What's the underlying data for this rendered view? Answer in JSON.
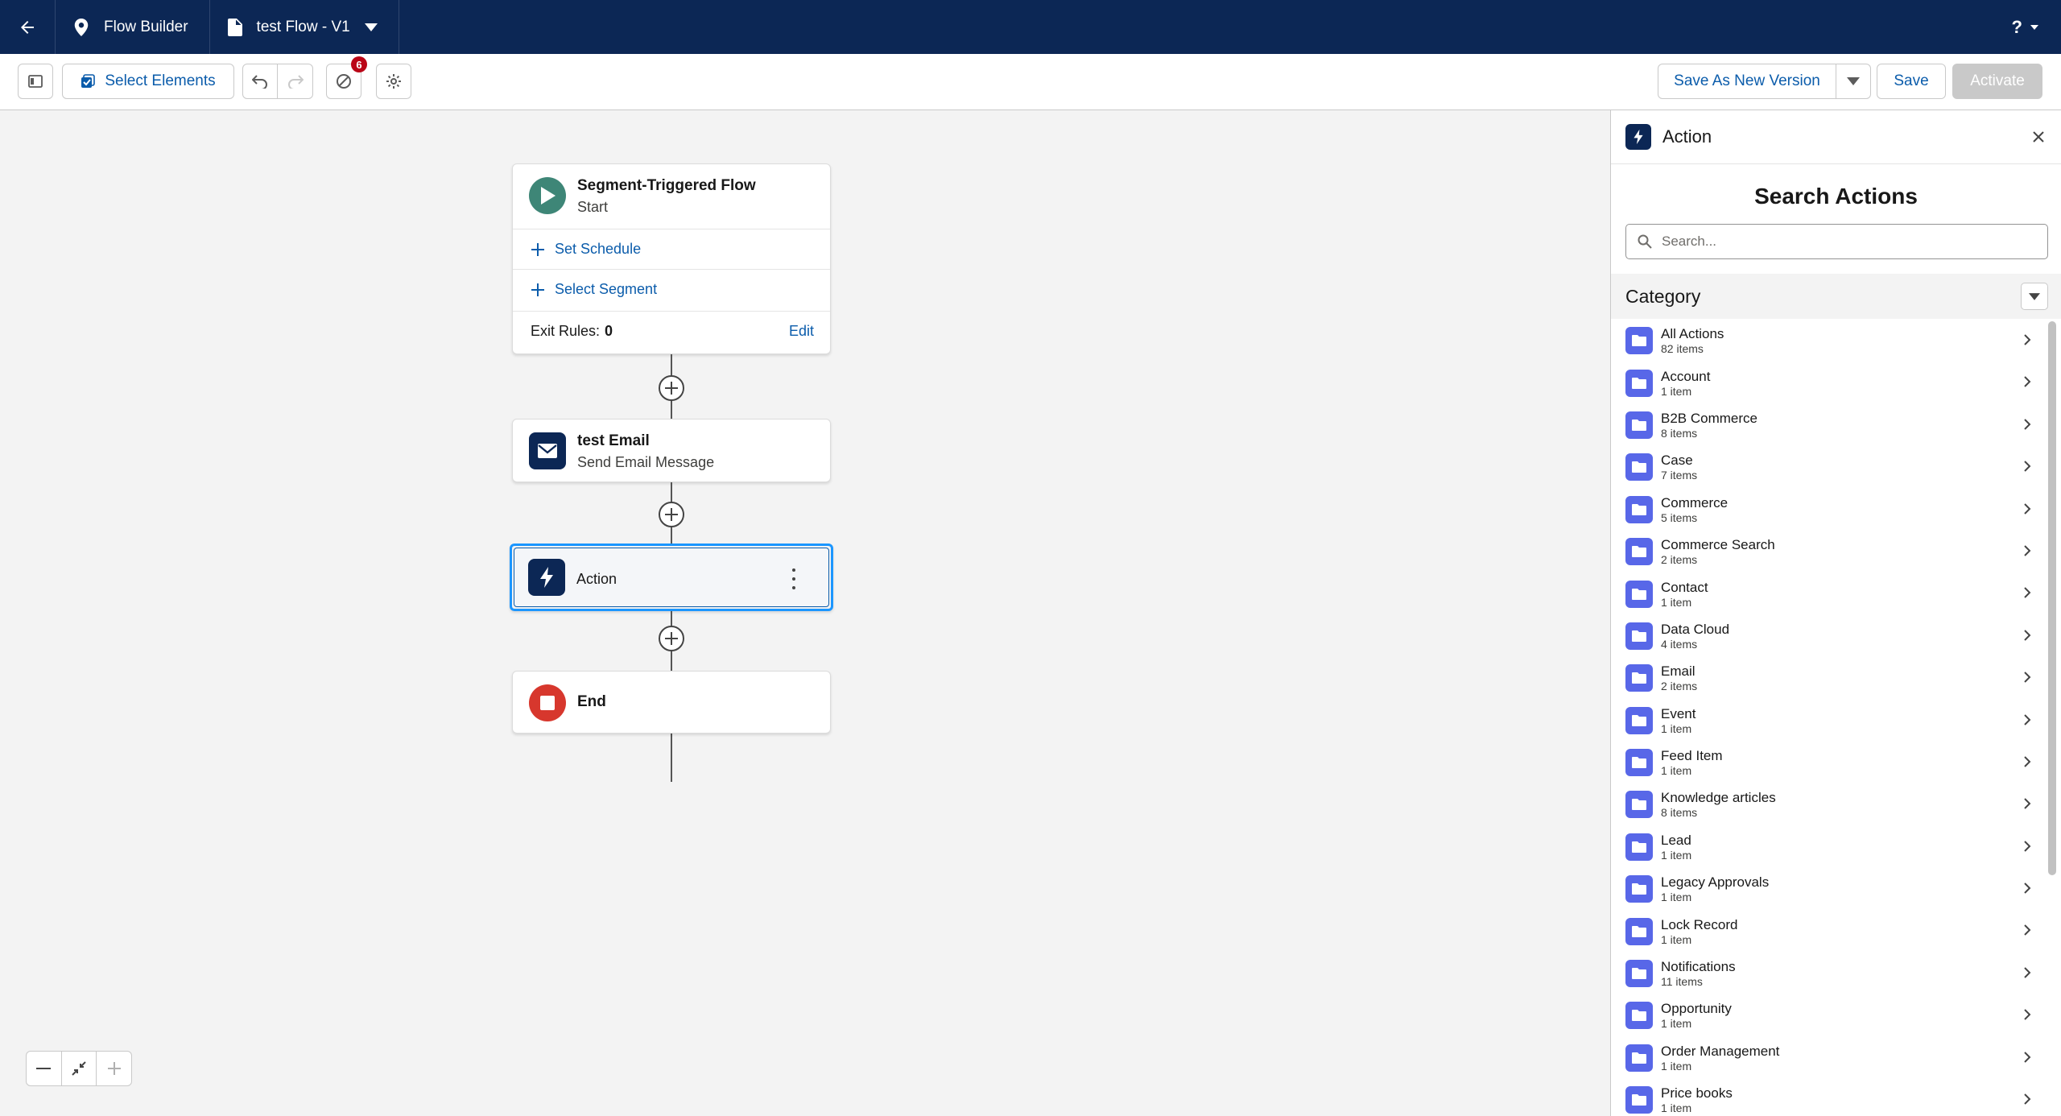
{
  "topbar": {
    "app_name": "Flow Builder",
    "flow_name": "test Flow - V1",
    "help_label": "?"
  },
  "toolbar": {
    "select_elements_label": "Select Elements",
    "error_count": "6",
    "save_as_new_version_label": "Save As New Version",
    "save_label": "Save",
    "activate_label": "Activate"
  },
  "canvas": {
    "start": {
      "title": "Segment-Triggered Flow",
      "subtitle": "Start",
      "set_schedule": "Set Schedule",
      "select_segment": "Select Segment",
      "exit_rules_label": "Exit Rules:",
      "exit_rules_value": "0",
      "edit_label": "Edit"
    },
    "email_node": {
      "title": "test Email",
      "subtitle": "Send Email Message"
    },
    "action_node": {
      "title": "Action"
    },
    "end_node": {
      "title": "End"
    }
  },
  "panel": {
    "header_title": "Action",
    "search_title": "Search Actions",
    "search_placeholder": "Search...",
    "category_label": "Category",
    "categories": [
      {
        "name": "All Actions",
        "count": "82 items"
      },
      {
        "name": "Account",
        "count": "1 item"
      },
      {
        "name": "B2B Commerce",
        "count": "8 items"
      },
      {
        "name": "Case",
        "count": "7 items"
      },
      {
        "name": "Commerce",
        "count": "5 items"
      },
      {
        "name": "Commerce Search",
        "count": "2 items"
      },
      {
        "name": "Contact",
        "count": "1 item"
      },
      {
        "name": "Data Cloud",
        "count": "4 items"
      },
      {
        "name": "Email",
        "count": "2 items"
      },
      {
        "name": "Event",
        "count": "1 item"
      },
      {
        "name": "Feed Item",
        "count": "1 item"
      },
      {
        "name": "Knowledge articles",
        "count": "8 items"
      },
      {
        "name": "Lead",
        "count": "1 item"
      },
      {
        "name": "Legacy Approvals",
        "count": "1 item"
      },
      {
        "name": "Lock Record",
        "count": "1 item"
      },
      {
        "name": "Notifications",
        "count": "11 items"
      },
      {
        "name": "Opportunity",
        "count": "1 item"
      },
      {
        "name": "Order Management",
        "count": "1 item"
      },
      {
        "name": "Price books",
        "count": "1 item"
      }
    ]
  },
  "colors": {
    "topbar": "#0c2755",
    "brand_blue": "#0b5cab",
    "start_icon": "#3e8677",
    "end_icon": "#d7372d",
    "folder_icon": "#5867e8",
    "error_badge": "#ba0517"
  },
  "icons": {
    "back": "arrow-left-icon",
    "app": "location-pin-icon",
    "flow": "document-icon",
    "start": "play-icon",
    "email": "envelope-icon",
    "action": "lightning-icon",
    "end": "stop-icon",
    "folder": "folder-icon"
  }
}
